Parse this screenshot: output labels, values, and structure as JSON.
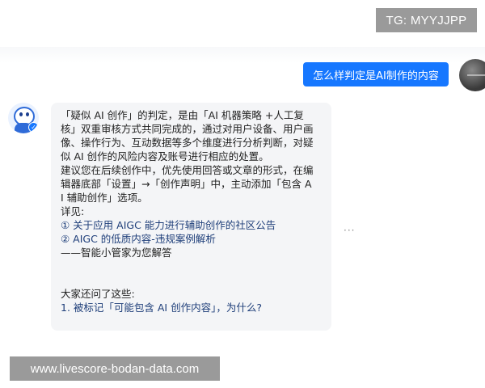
{
  "tg_badge": "TG: MYYJJPP",
  "user_message": "怎么样判定是AI制作的内容",
  "answer": {
    "line1": "「疑似 AI 创作」的判定，是由「AI 机器策略 +人工复",
    "line2": "核」双重审核方式共同完成的，通过对用户设备、用户画",
    "line3": "像、操作行为、互动数据等多个维度进行分析判断，对疑",
    "line4": "似 AI 创作的风险内容及账号进行相应的处置。",
    "line5": "建议您在后续创作中，优先使用回答或文章的形式，在编",
    "line6": "辑器底部「设置」→「创作声明」中，主动添加「包含 A",
    "line7": "I 辅助创作」选项。",
    "see_also_label": "详见:",
    "link1": "① 关于应用 AIGC 能力进行辅助创作的社区公告",
    "link2": "② AIGC 的低质内容-违规案例解析",
    "signoff": "——智能小管家为您解答",
    "related_label": "大家还问了这些:",
    "related1": "1. 被标记「可能包含 AI 创作内容」，为什么?"
  },
  "more_icon": "···",
  "watermark": "www.livescore-bodan-data.com",
  "colors": {
    "accent": "#1677ff",
    "bubble": "#f4f5f7",
    "overlay": "#9a9a9a"
  }
}
